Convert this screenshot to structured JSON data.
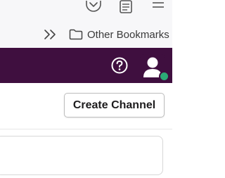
{
  "browser": {
    "toolbar_icons": [
      "pocket-icon",
      "reader-view-icon",
      "hamburger-menu-icon"
    ],
    "bookmarks_overflow_icon": "double-chevron-right-icon",
    "bookmarks_folder_icon": "folder-icon",
    "bookmarks_folder_label": "Other Bookmarks"
  },
  "app_header": {
    "background_color": "#3f0f3f",
    "help_icon": "question-circle-icon",
    "avatar_icon": "user-avatar-icon",
    "presence_color": "#2bac76"
  },
  "main": {
    "create_channel_label": "Create Channel"
  }
}
